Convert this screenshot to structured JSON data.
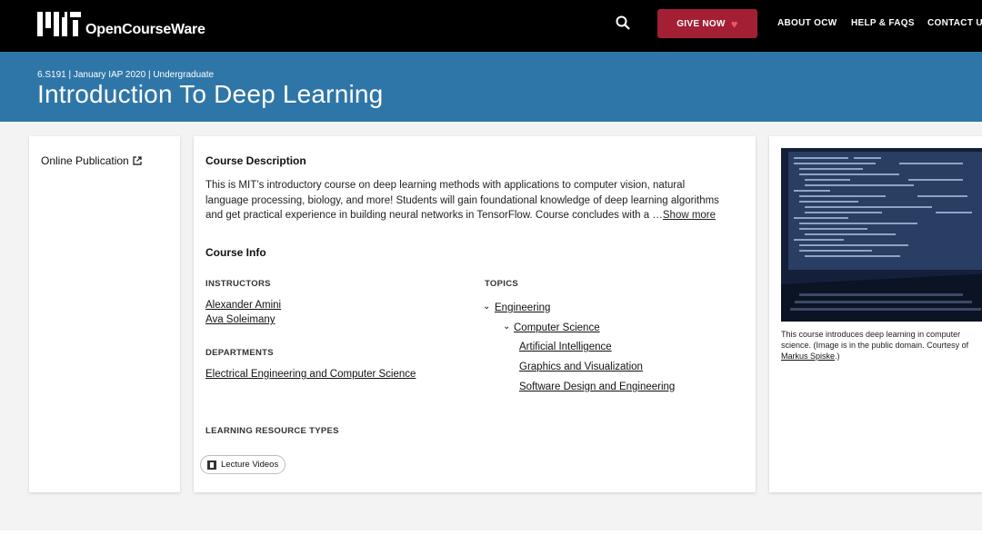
{
  "header": {
    "logo_text": "OpenCourseWare",
    "give_label": "GIVE NOW",
    "nav": [
      "ABOUT OCW",
      "HELP & FAQS",
      "CONTACT US"
    ]
  },
  "hero": {
    "meta": "6.S191 | January IAP 2020 | Undergraduate",
    "title": "Introduction To Deep Learning"
  },
  "sidebar": {
    "online_publication": "Online Publication"
  },
  "course": {
    "description_heading": "Course Description",
    "description": "This is MIT’s introductory course on deep learning methods with applications to computer vision, natural language processing, biology, and more! Students will gain foundational knowledge of deep learning algorithms and get practical experience in building neural networks in TensorFlow. Course concludes with a …",
    "show_more": "Show more",
    "info_heading": "Course Info",
    "instructors_label": "INSTRUCTORS",
    "instructors": [
      "Alexander Amini",
      "Ava Soleimany"
    ],
    "departments_label": "DEPARTMENTS",
    "departments": [
      "Electrical Engineering and Computer Science"
    ],
    "topics_label": "TOPICS",
    "topics": {
      "level1": "Engineering",
      "level2": "Computer Science",
      "level3": [
        "Artificial Intelligence",
        "Graphics and Visualization",
        "Software Design and Engineering"
      ]
    },
    "resource_types_label": "LEARNING RESOURCE TYPES",
    "resource_types": [
      "Lecture Videos"
    ]
  },
  "image_panel": {
    "caption_text": "This course introduces deep learning in computer science. (Image is in the public domain. Courtesy of",
    "caption_author": "Markus Spiske",
    "caption_end": ".)"
  },
  "colors": {
    "header_bg": "#000000",
    "hero_bg": "#2f76a8",
    "give_button": "#a31f34"
  }
}
